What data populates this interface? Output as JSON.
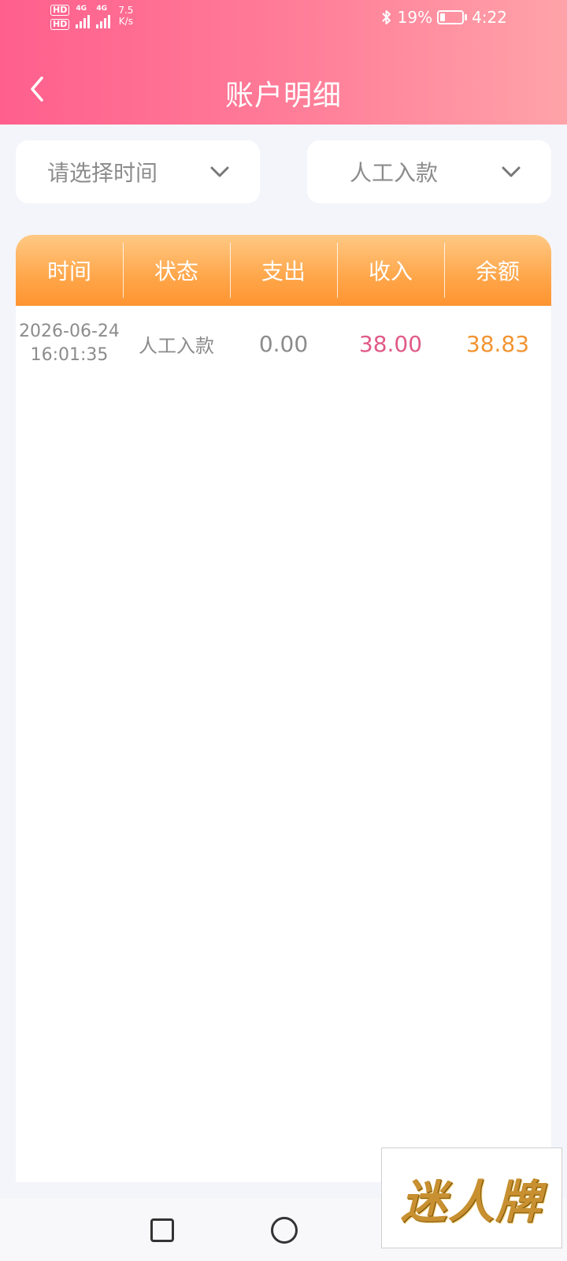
{
  "status_bar": {
    "hd1": "HD",
    "hd2": "HD",
    "sim1": "4G",
    "sim2": "4G",
    "net_speed_value": "7.5",
    "net_speed_unit": "K/s",
    "battery_percent": "19%",
    "time": "4:22",
    "icons": [
      "bluetooth-icon",
      "battery-charging-icon"
    ]
  },
  "header": {
    "title": "账户明细",
    "back_icon": "chevron-left-icon"
  },
  "filters": {
    "time": {
      "label": "请选择时间",
      "icon": "chevron-down-icon"
    },
    "type": {
      "label": "人工入款",
      "icon": "chevron-down-icon"
    }
  },
  "table": {
    "columns": [
      "时间",
      "状态",
      "支出",
      "收入",
      "余额"
    ],
    "rows": [
      {
        "date": "2026-06-24",
        "time": "16:01:35",
        "status": "人工入款",
        "expense": "0.00",
        "income": "38.00",
        "balance": "38.83"
      }
    ]
  },
  "colors": {
    "header_gradient_start": "#ff5f8d",
    "header_gradient_end": "#ffa3a9",
    "table_header_orange": "#ff9430",
    "income_pink": "#e05a86",
    "balance_orange": "#f29431"
  },
  "watermark": {
    "text": "迷人牌"
  }
}
